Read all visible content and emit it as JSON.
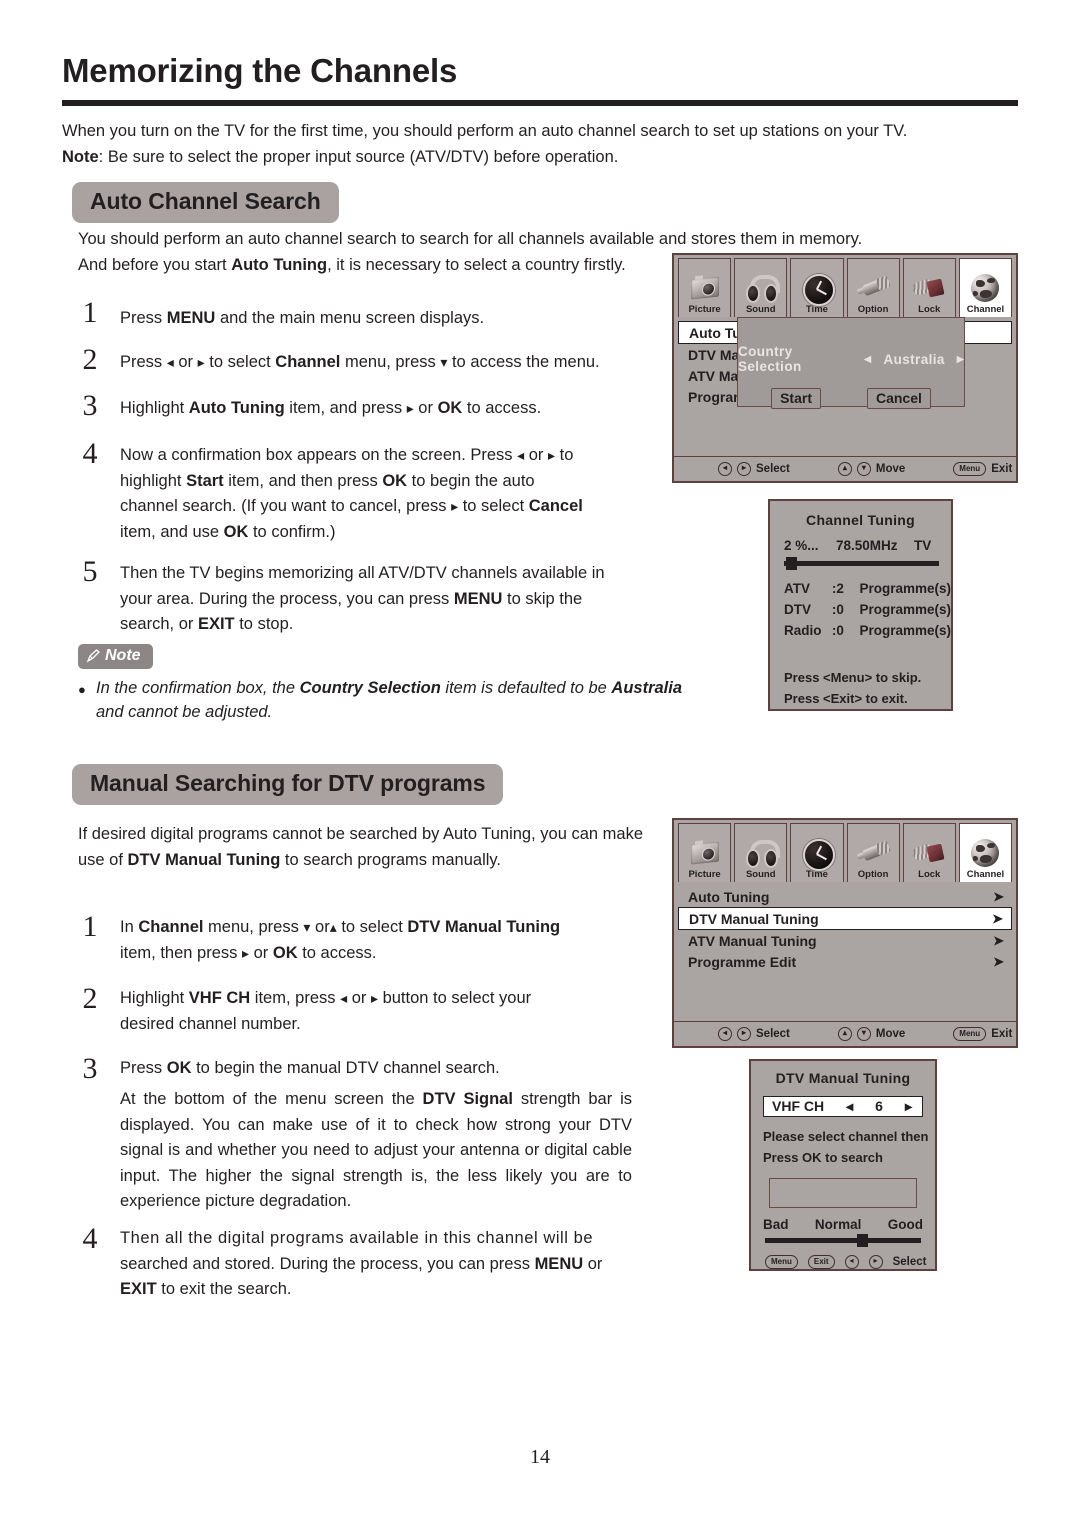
{
  "page": {
    "title": "Memorizing the Channels",
    "number": "14"
  },
  "intro": {
    "line1": "When you turn on the TV for the first time, you should perform an auto channel search to set up stations on your TV.",
    "note_label": "Note",
    "note_rest": ":  Be sure to select the proper input source (ATV/DTV) before operation."
  },
  "auto_section": {
    "heading": "Auto Channel Search",
    "lead1": "You should perform an auto channel search to search for all channels available and stores them in memory.",
    "lead2_a": "And before you start ",
    "lead2_b": "Auto Tuning",
    "lead2_c": ", it is necessary to select a country firstly.",
    "steps": [
      {
        "num": "1",
        "html_id": "a1"
      },
      {
        "num": "2",
        "html_id": "a2"
      },
      {
        "num": "3",
        "html_id": "a3"
      },
      {
        "num": "4",
        "html_id": "a4"
      },
      {
        "num": "5",
        "html_id": "a5"
      }
    ],
    "step1": {
      "t1": "Press ",
      "b1": "MENU",
      "t2": " and the main menu screen displays."
    },
    "step2": {
      "t1": "Press ",
      "a1": "◂",
      "t2": " or ",
      "a2": "▸",
      "t3": " to select ",
      "b1": "Channel",
      "t4": " menu,  press ",
      "a3": "▾",
      "t5": " to access the menu."
    },
    "step3": {
      "t1": "Highlight ",
      "b1": "Auto Tuning",
      "t2": " item, and press ",
      "a1": "▸",
      "t3": " or ",
      "b2": "OK",
      "t4": " to access."
    },
    "step4": {
      "l1a": "Now a confirmation box appears on the screen. Press ",
      "l1b": "◂",
      "l1c": " or ",
      "l1d": "▸",
      "l1e": " to",
      "l2a": "highlight ",
      "l2b": "Start",
      "l2c": " item, and then press ",
      "l2d": "OK",
      "l2e": " to begin the auto",
      "l3a": "channel search. (If you want to cancel, press ",
      "l3b": "▸",
      "l3c": " to select ",
      "l3d": "Cancel",
      "l4a": "item, and use ",
      "l4b": "OK",
      "l4c": " to confirm.)"
    },
    "step5": {
      "l1": "Then the TV begins memorizing all ATV/DTV channels available in",
      "l2a": "your area. During the process, you can press ",
      "l2b": "MENU",
      "l2c": " to skip the",
      "l3a": "search, or ",
      "l3b": "EXIT",
      "l3c": " to stop."
    },
    "note": {
      "label": "Note",
      "bullet": "●",
      "t1": "In the confirmation box, the ",
      "b1": "Country Selection",
      "t2": " item is defaulted to be ",
      "b2": "Australia",
      "t3": "and cannot be adjusted."
    }
  },
  "manual_section": {
    "heading": "Manual Searching for DTV programs",
    "lead_l1": "If desired digital programs cannot be searched by Auto Tuning, you can make",
    "lead_l2a": "use of ",
    "lead_l2b": "DTV Manual Tuning",
    "lead_l2c": " to search programs manually.",
    "step1": {
      "num": "1",
      "l1a": "In ",
      "l1b": "Channel",
      "l1c": " menu,  press ",
      "l1d": "▾",
      "l1e": " or",
      "l1f": "▴",
      "l1g": " to select ",
      "l1h": "DTV Manual Tuning",
      "l2a": "item, then press ",
      "l2b": "▸",
      "l2c": " or ",
      "l2d": "OK",
      "l2e": " to access."
    },
    "step2": {
      "num": "2",
      "l1a": "Highlight ",
      "l1b": "VHF  CH",
      "l1c": " item, press ",
      "l1d": "◂",
      "l1e": " or ",
      "l1f": "▸",
      "l1g": " button to select your",
      "l2": "desired channel number."
    },
    "step3": {
      "num": "3",
      "l1a": "Press ",
      "l1b": "OK",
      "l1c": " to begin the manual DTV  channel search.",
      "p1a": "At the bottom of the menu screen the ",
      "p1b": "DTV Signal",
      "p1c": " strength bar is displayed. You can make use of it to check how strong your DTV signal is and whether you need to adjust your antenna or digital cable input. The higher the signal strength is, the less likely you are to experience picture degradation."
    },
    "step4": {
      "num": "4",
      "l1": "Then all the digital programs available in this channel will be",
      "l2a": "searched and stored. During the process, you can press ",
      "l2b": "MENU",
      "l2c": " or",
      "l3a": "EXIT",
      "l3b": " to exit the search."
    }
  },
  "tv_menu": {
    "tabs": [
      {
        "label": "Picture",
        "icon": "camera-icon"
      },
      {
        "label": "Sound",
        "icon": "headphones-icon"
      },
      {
        "label": "Time",
        "icon": "clock-icon"
      },
      {
        "label": "Option",
        "icon": "connector-icon"
      },
      {
        "label": "Lock",
        "icon": "padlock-icon"
      },
      {
        "label": "Channel",
        "icon": "globe-icon"
      }
    ],
    "active_tab": "Channel",
    "hints": {
      "select_label": "Select",
      "move_label": "Move",
      "exit_label": "Exit",
      "menu_key": "Menu",
      "exit_key": "Exit",
      "left_key": "◂",
      "right_key": "▸",
      "up_key": "▴",
      "down_key": "▾"
    },
    "items": [
      {
        "label": "Auto Tuning",
        "arrow": "➤"
      },
      {
        "label": "DTV Manual Tuning",
        "arrow": "➤"
      },
      {
        "label": "ATV Manual Tuning",
        "arrow": "➤"
      },
      {
        "label": "Programme Edit",
        "arrow": "➤"
      }
    ],
    "selected_item": "DTV Manual Tuning",
    "truncated_items": [
      {
        "label": "Auto Tun"
      },
      {
        "label": "DTV Man"
      },
      {
        "label": "ATV Man"
      },
      {
        "label": "Program"
      }
    ]
  },
  "country_dialog": {
    "label": "Country  Selection",
    "left_arrow": "◂",
    "right_arrow": "▸",
    "value": "Australia",
    "start_button": "Start",
    "cancel_button": "Cancel"
  },
  "channel_tuning_dialog": {
    "title": "Channel  Tuning",
    "percent": "2  %...",
    "frequency": "78.50MHz",
    "mode": "TV",
    "progress_percent": 2,
    "rows": [
      {
        "name": "ATV",
        "count": ":2",
        "unit": "Programme(s)"
      },
      {
        "name": "DTV",
        "count": ":0",
        "unit": "Programme(s)"
      },
      {
        "name": "Radio",
        "count": ":0",
        "unit": "Programme(s)"
      }
    ],
    "hint1": "Press <Menu> to skip.",
    "hint2": "Press <Exit> to exit."
  },
  "dtv_manual_dialog": {
    "title": "DTV Manual Tuning",
    "field_label": "VHF  CH",
    "left_arrow": "◂",
    "value": "6",
    "right_arrow": "▸",
    "instruction_l1": "Please select channel then",
    "instruction_l2": "Press OK to search",
    "scale_bad": "Bad",
    "scale_normal": "Normal",
    "scale_good": "Good",
    "signal_level_percent": 62,
    "hint_menu": "Menu",
    "hint_exit": "Exit",
    "hint_select": "Select",
    "hint_left": "◂",
    "hint_right": "▸"
  },
  "colors": {
    "ink": "#231f20",
    "pill_grey": "#a9a2a1",
    "menu_grey": "#aaa4a3",
    "menu_border": "#5d4040",
    "note_grey": "#8c8786"
  }
}
